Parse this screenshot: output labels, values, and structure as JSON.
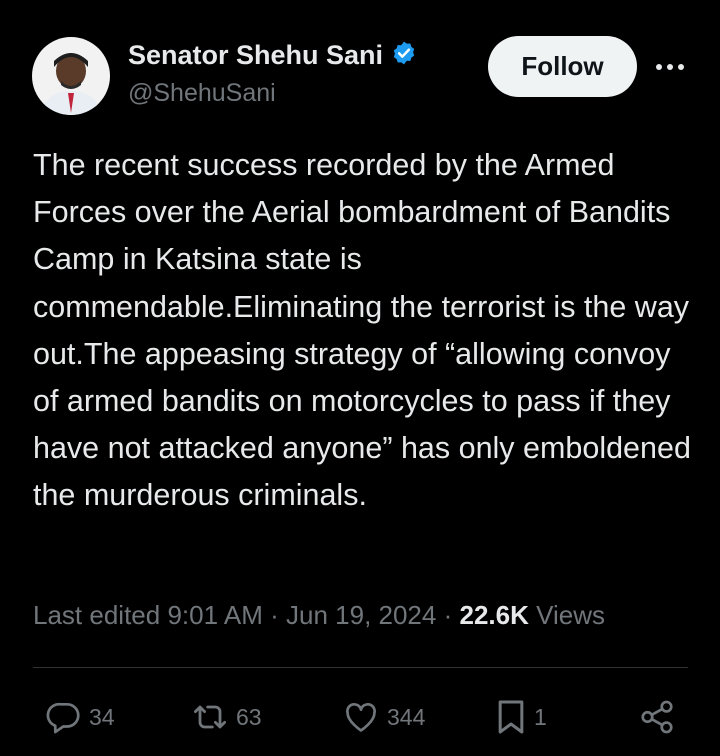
{
  "author": {
    "name": "Senator Shehu Sani",
    "handle": "@ShehuSani",
    "verified": true,
    "verified_color": "#1d9bf0"
  },
  "follow_label": "Follow",
  "tweet": {
    "text": "The recent success recorded by the Armed Forces over the Aerial bombardment of Bandits Camp in Katsina state is commendable.Eliminating the terrorist is the way out.The appeasing strategy of “allowing convoy of armed bandits on motorcycles to pass if they have not attacked anyone” has only emboldened the murderous criminals.",
    "edited_prefix": "Last edited",
    "time": "9:01 AM",
    "date": "Jun 19, 2024",
    "views_count": "22.6K",
    "views_label": "Views"
  },
  "actions": {
    "replies": "34",
    "reposts": "63",
    "likes": "344",
    "bookmarks": "1"
  },
  "icons": [
    "verified-icon",
    "more-icon",
    "reply-icon",
    "repost-icon",
    "like-icon",
    "bookmark-icon",
    "share-icon"
  ]
}
